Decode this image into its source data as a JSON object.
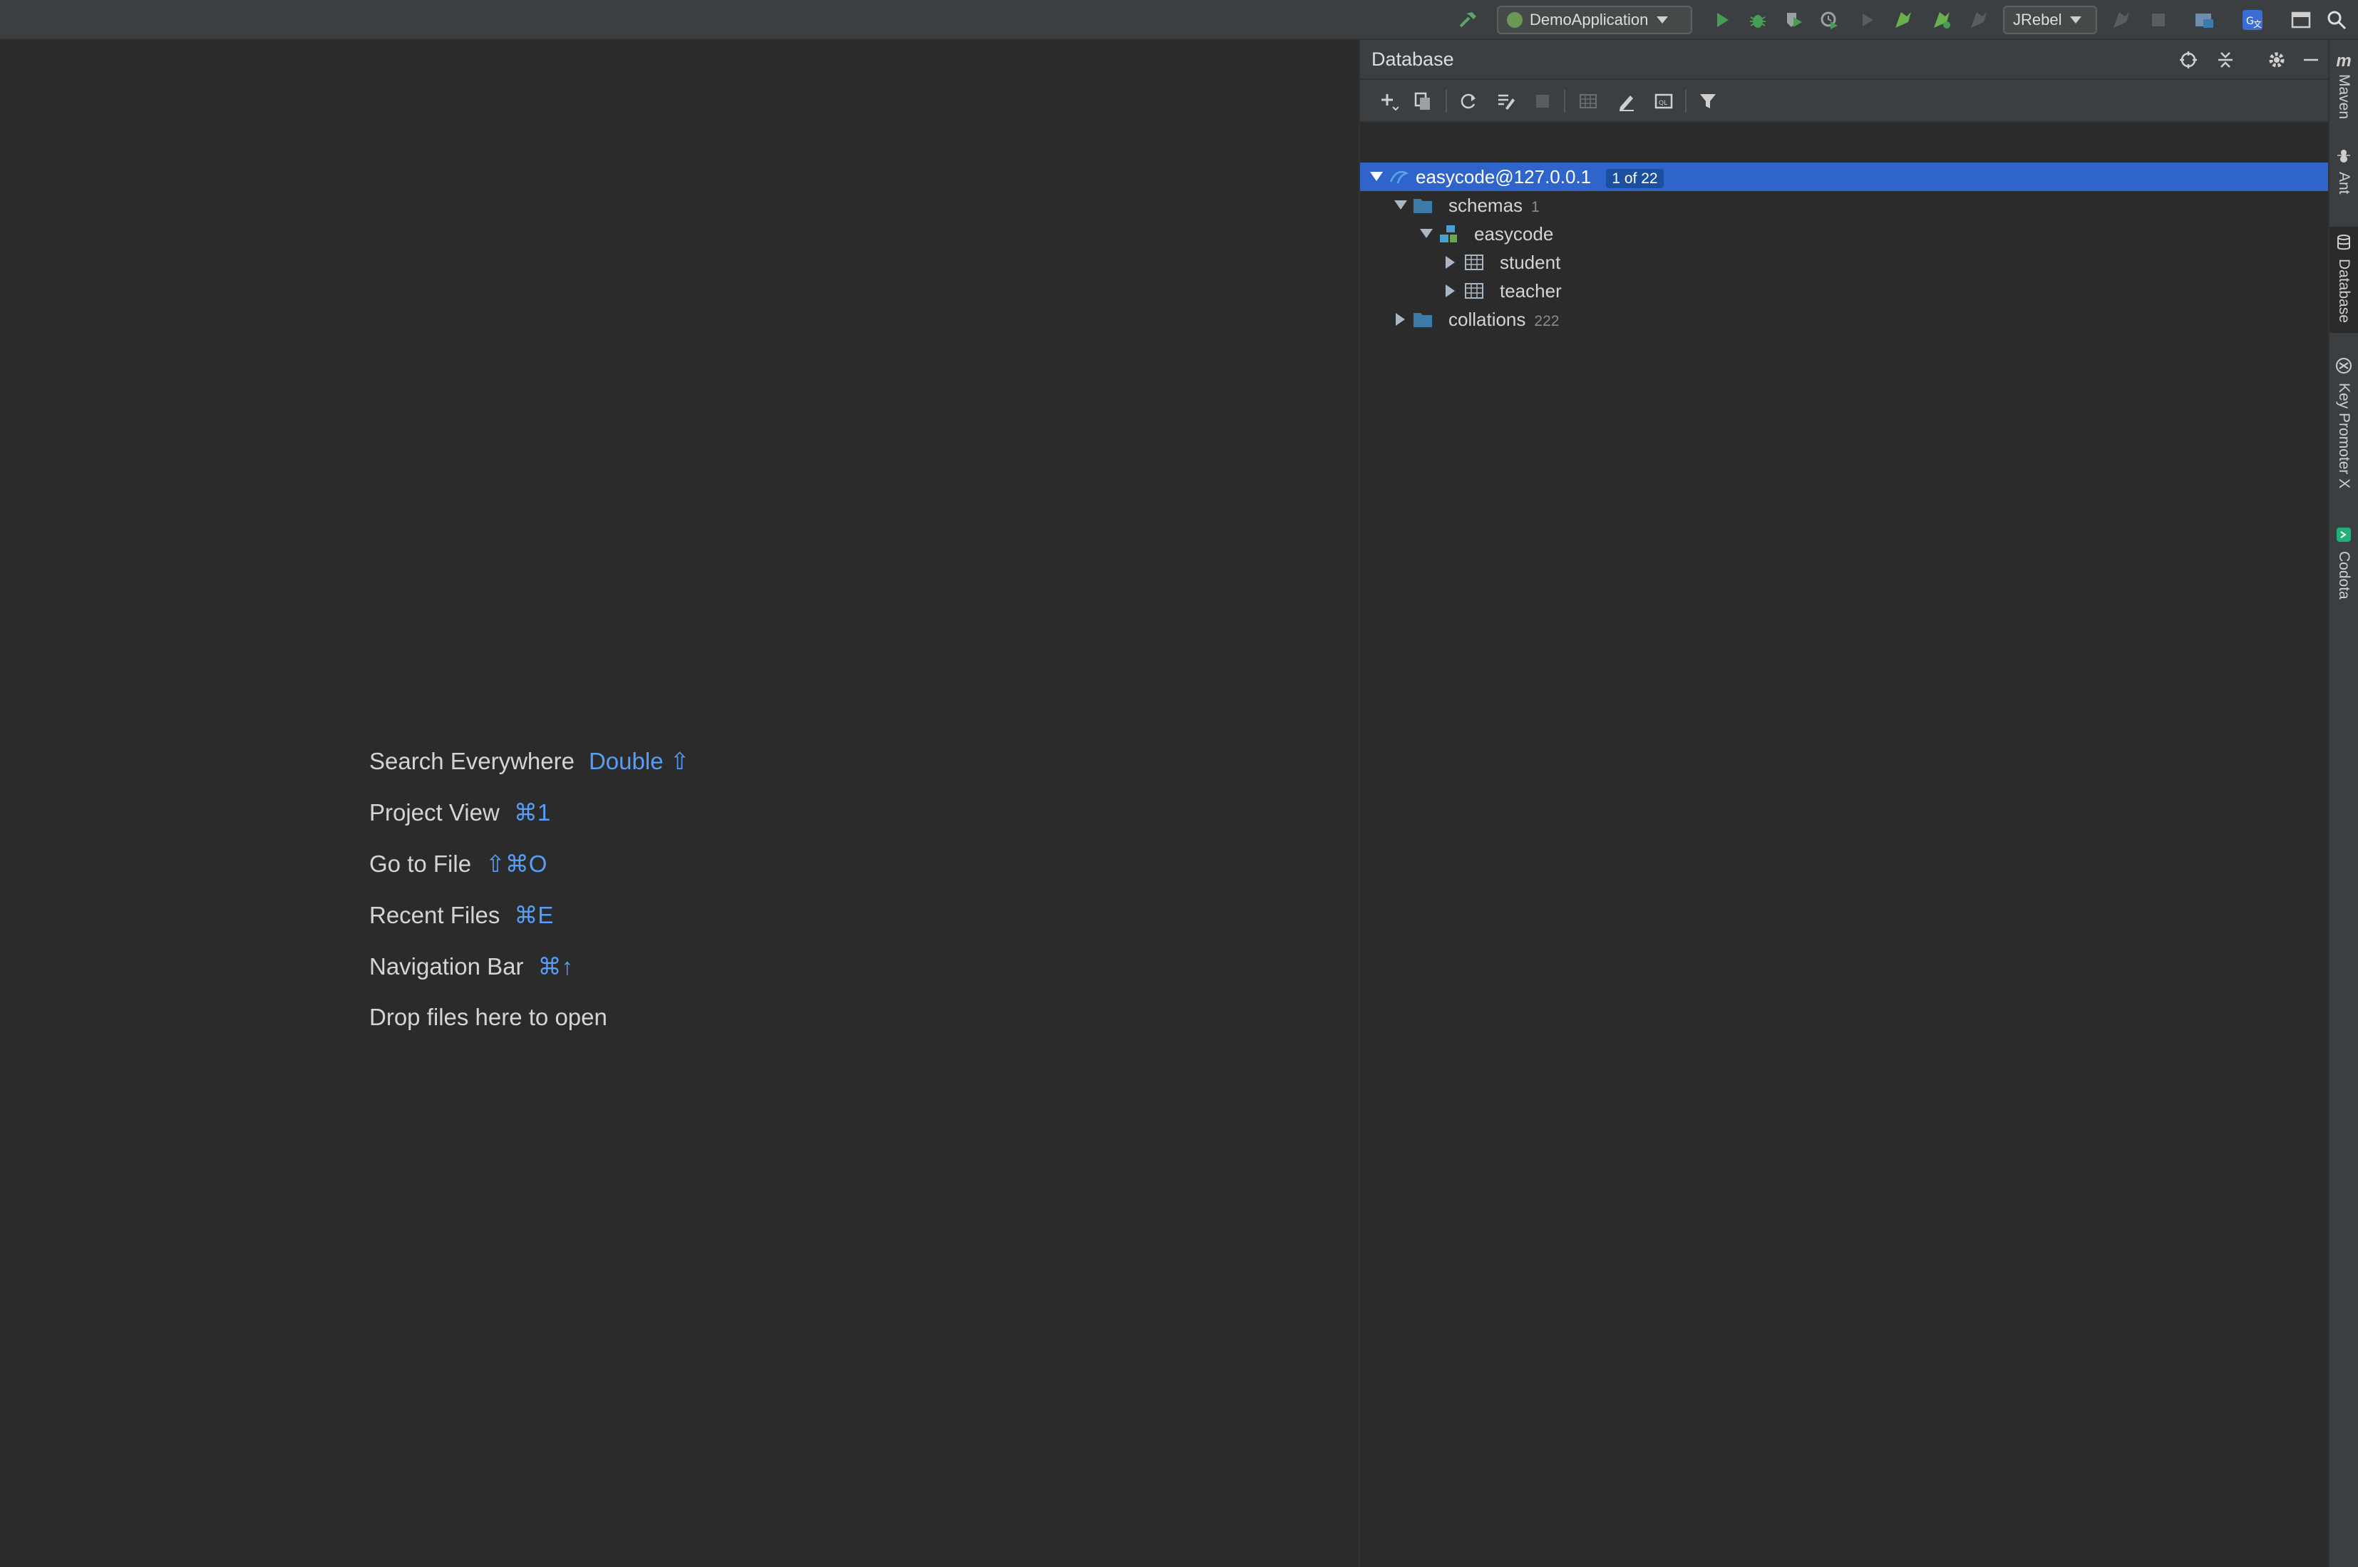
{
  "toolbar": {
    "run_config": "DemoApplication",
    "jrebel_config": "JRebel",
    "icons": [
      "hammer-icon",
      "run-icon",
      "debug-icon",
      "coverage-icon",
      "profile-icon",
      "run-disabled-icon",
      "jrebel-run-icon",
      "jrebel-debug-icon",
      "jrebel-disabled-icon",
      "attach-icon",
      "stop-icon",
      "project-structure-icon",
      "translate-icon",
      "presentation-icon",
      "search-icon"
    ]
  },
  "welcome": {
    "hints": [
      {
        "label": "Search Everywhere",
        "shortcut": "Double ⇧"
      },
      {
        "label": "Project View",
        "shortcut": "⌘1"
      },
      {
        "label": "Go to File",
        "shortcut": "⇧⌘O"
      },
      {
        "label": "Recent Files",
        "shortcut": "⌘E"
      },
      {
        "label": "Navigation Bar",
        "shortcut": "⌘↑"
      },
      {
        "label": "Drop files here to open",
        "shortcut": ""
      }
    ]
  },
  "database": {
    "title": "Database",
    "tree": {
      "datasource": {
        "label": "easycode@127.0.0.1",
        "badge": "1 of 22"
      },
      "schemas": {
        "label": "schemas",
        "count": "1"
      },
      "schema": {
        "label": "easycode"
      },
      "tables": [
        {
          "label": "student"
        },
        {
          "label": "teacher"
        }
      ],
      "collations": {
        "label": "collations",
        "count": "222"
      }
    }
  },
  "right_strip": {
    "tabs": [
      {
        "label": "Maven"
      },
      {
        "label": "Ant"
      },
      {
        "label": "Database"
      },
      {
        "label": "Key Promoter X"
      },
      {
        "label": "Codota"
      }
    ]
  },
  "colors": {
    "background": "#2b2b2b",
    "panel": "#3c3f41",
    "selection": "#2f65ca",
    "shortcut": "#589df6",
    "run_green": "#499c54",
    "folder_blue": "#3d7ca8"
  }
}
